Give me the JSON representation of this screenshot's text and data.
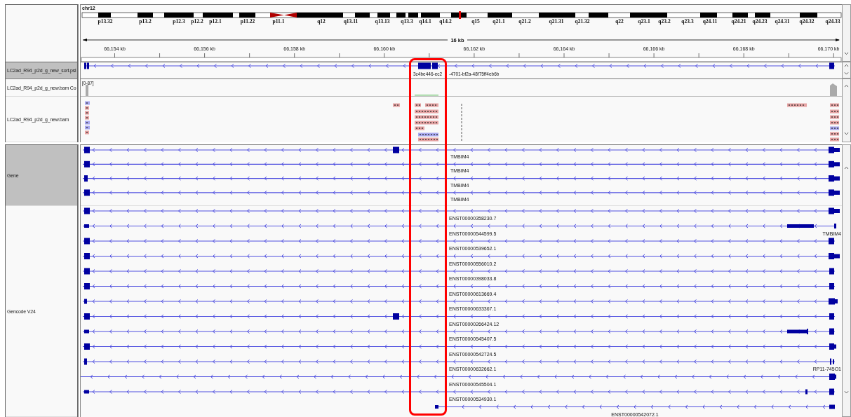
{
  "header": {
    "chromosome": "chr12",
    "bands": [
      "p13.32",
      "p13.2",
      "p12.3",
      "p12.2",
      "p12.1",
      "p11.22",
      "p11.1",
      "q12",
      "q13.11",
      "q13.13",
      "q13.3",
      "q14.1",
      "q14.2",
      "q15",
      "q21.1",
      "q21.2",
      "q21.31",
      "q21.32",
      "q22",
      "q23.1",
      "q23.2",
      "q23.3",
      "q24.11",
      "q24.21",
      "q24.23",
      "q24.31",
      "q24.32",
      "q24.33"
    ],
    "span": "16 kb",
    "ticks": [
      "66,154 kb",
      "66,156 kb",
      "66,158 kb",
      "66,160 kb",
      "66,162 kb",
      "66,164 kb",
      "66,166 kb",
      "66,168 kb",
      "66,170 kb"
    ]
  },
  "tracks": [
    {
      "kind": "psl",
      "name": "LC2ad_R94_p2d_g_new_sort.psl",
      "selected": true,
      "feature": {
        "label_start": "3c4be446-ec2",
        "label_end": "-4701-bf2a-48f75ff4eb6b"
      }
    },
    {
      "kind": "coverage",
      "name": "LC2ad_R94_p2d_g_new.bam Co",
      "selected": false,
      "range": "[0-87]"
    },
    {
      "kind": "alignment",
      "name": "LC2ad_R94_p2d_g_new.bam",
      "selected": false
    },
    {
      "kind": "gene",
      "name": "Gene",
      "selected": true,
      "features": [
        {
          "label": "TMBIM4"
        },
        {
          "label": "TMBIM4"
        },
        {
          "label": "TMBIM4"
        },
        {
          "label": "TMBIM4"
        }
      ]
    },
    {
      "kind": "gencode",
      "name": "Gencode V24",
      "selected": false,
      "features": [
        {
          "label": "ENST00000358230.7"
        },
        {
          "label": "ENST00000544599.5",
          "side_label": "TMBIM4"
        },
        {
          "label": "ENST00000539652.1"
        },
        {
          "label": "ENST00000556010.2"
        },
        {
          "label": "ENST00000398033.8"
        },
        {
          "label": "ENST00000613669.4"
        },
        {
          "label": "ENST00000633367.1"
        },
        {
          "label": "ENST00000266424.12"
        },
        {
          "label": "ENST00000545407.5"
        },
        {
          "label": "ENST00000542724.5"
        },
        {
          "label": "ENST00000632662.1",
          "side_label": "RP11-745O1"
        },
        {
          "label": "ENST00000545504.1"
        },
        {
          "label": "ENST00000534930.1"
        },
        {
          "label": "ENST00000542072.1"
        }
      ]
    }
  ]
}
